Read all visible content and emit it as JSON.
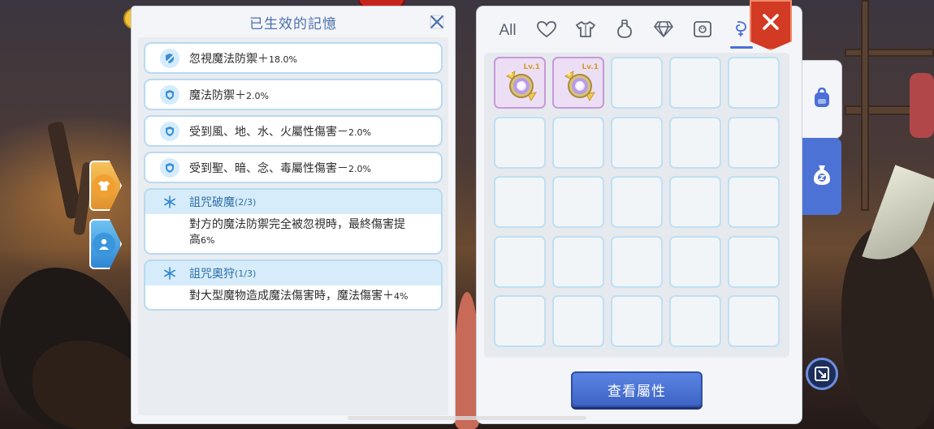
{
  "memory_panel": {
    "title": "已生效的記憶",
    "effects": [
      {
        "icon": "broken-shield-icon",
        "label": "忽視魔法防禦＋",
        "value": "18.0%"
      },
      {
        "icon": "shield-icon",
        "label": "魔法防禦＋",
        "value": "2.0%"
      },
      {
        "icon": "shield-icon",
        "label": "受到風、地、水、火屬性傷害－",
        "value": "2.0%"
      },
      {
        "icon": "shield-icon",
        "label": "受到聖、暗、念、毒屬性傷害－",
        "value": "2.0%"
      }
    ],
    "sets": [
      {
        "icon": "snowflake-icon",
        "name": "詛咒破魔",
        "progress": "(2/3)",
        "desc_line1": "對方的魔法防禦完全被忽視時，最終傷害提",
        "desc_line2": "高",
        "desc_value": "6%"
      },
      {
        "icon": "snowflake-icon",
        "name": "詛咒奧狩",
        "progress": "(1/3)",
        "desc_line1": "對大型魔物造成魔法傷害時，魔法傷害＋",
        "desc_line2": "",
        "desc_value": "4%"
      }
    ]
  },
  "inventory": {
    "tabs": [
      {
        "label": "All",
        "icon": "all-tab"
      },
      {
        "icon": "heart-icon"
      },
      {
        "icon": "shirt-icon"
      },
      {
        "icon": "potion-bottle-icon"
      },
      {
        "icon": "diamond-icon"
      },
      {
        "icon": "card-icon"
      },
      {
        "icon": "memory-gem-icon",
        "active": true
      }
    ],
    "items": [
      {
        "level": "Lv.1",
        "icon": "purple-gem-icon"
      },
      {
        "level": "Lv.1",
        "icon": "purple-gem-icon"
      }
    ],
    "slot_count": 25,
    "view_button": "查看屬性"
  },
  "colors": {
    "accent_blue": "#4b6ed8",
    "title_blue": "#4a6fae",
    "close_red": "#d23a24",
    "slot_border": "#bfe0f2",
    "filled_slot_border": "#c69ad8"
  }
}
